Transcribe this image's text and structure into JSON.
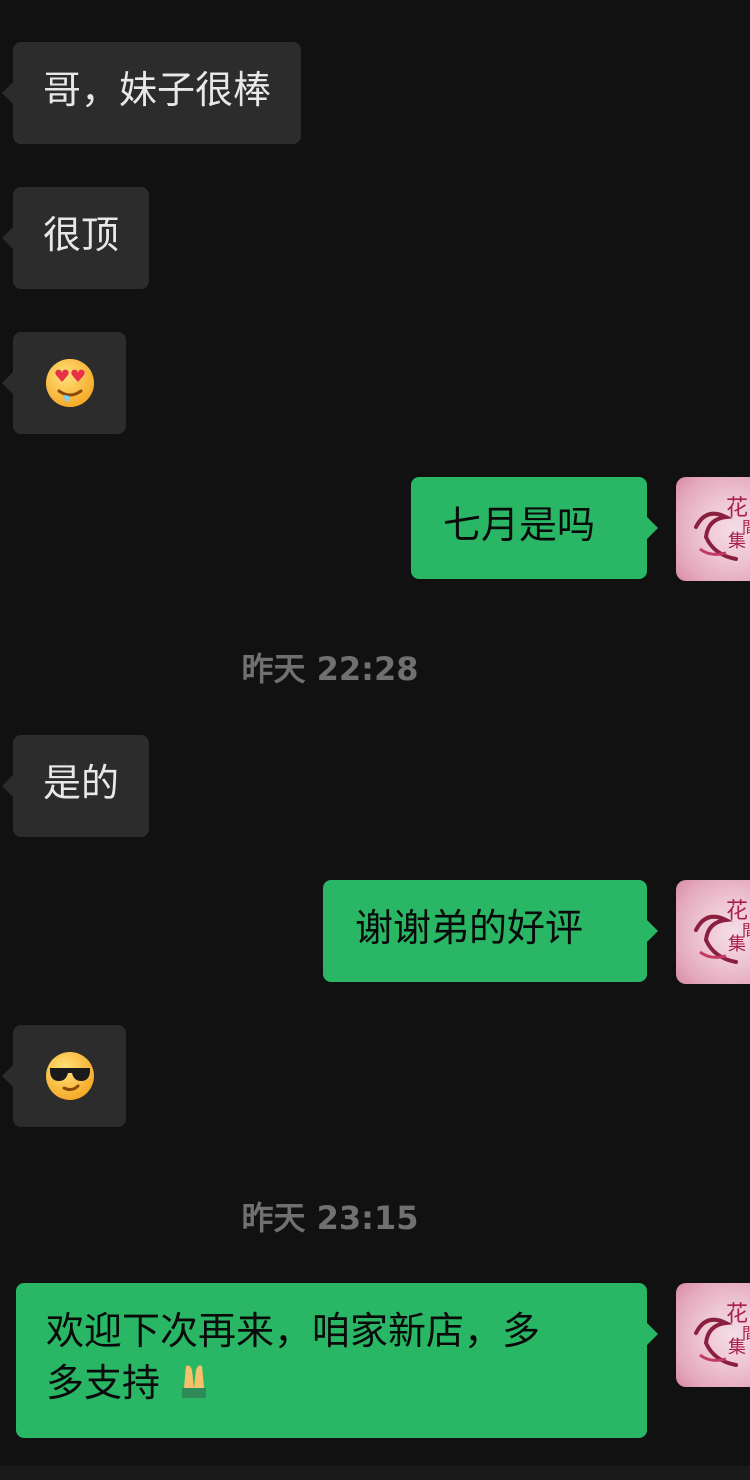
{
  "messages": {
    "m1": "哥，妹子很棒",
    "m2": "很顶",
    "m3_emoji": "smiling-face-with-heart-eyes-drooling",
    "m4": "七月是吗",
    "ts1": "昨天 22:28",
    "m5": "是的",
    "m6": "谢谢弟的好评",
    "m7_emoji": "smiling-face-with-sunglasses",
    "ts2": "昨天 23:15",
    "m8_line1": "欢迎下次再来，咱家新店，多",
    "m8_line2": "多支持"
  },
  "avatar": {
    "shop_logo_text": "花間集"
  },
  "colors": {
    "background": "#111111",
    "incoming_bubble": "#2c2c2c",
    "outgoing_bubble": "#29b765",
    "timestamp": "#707070"
  }
}
